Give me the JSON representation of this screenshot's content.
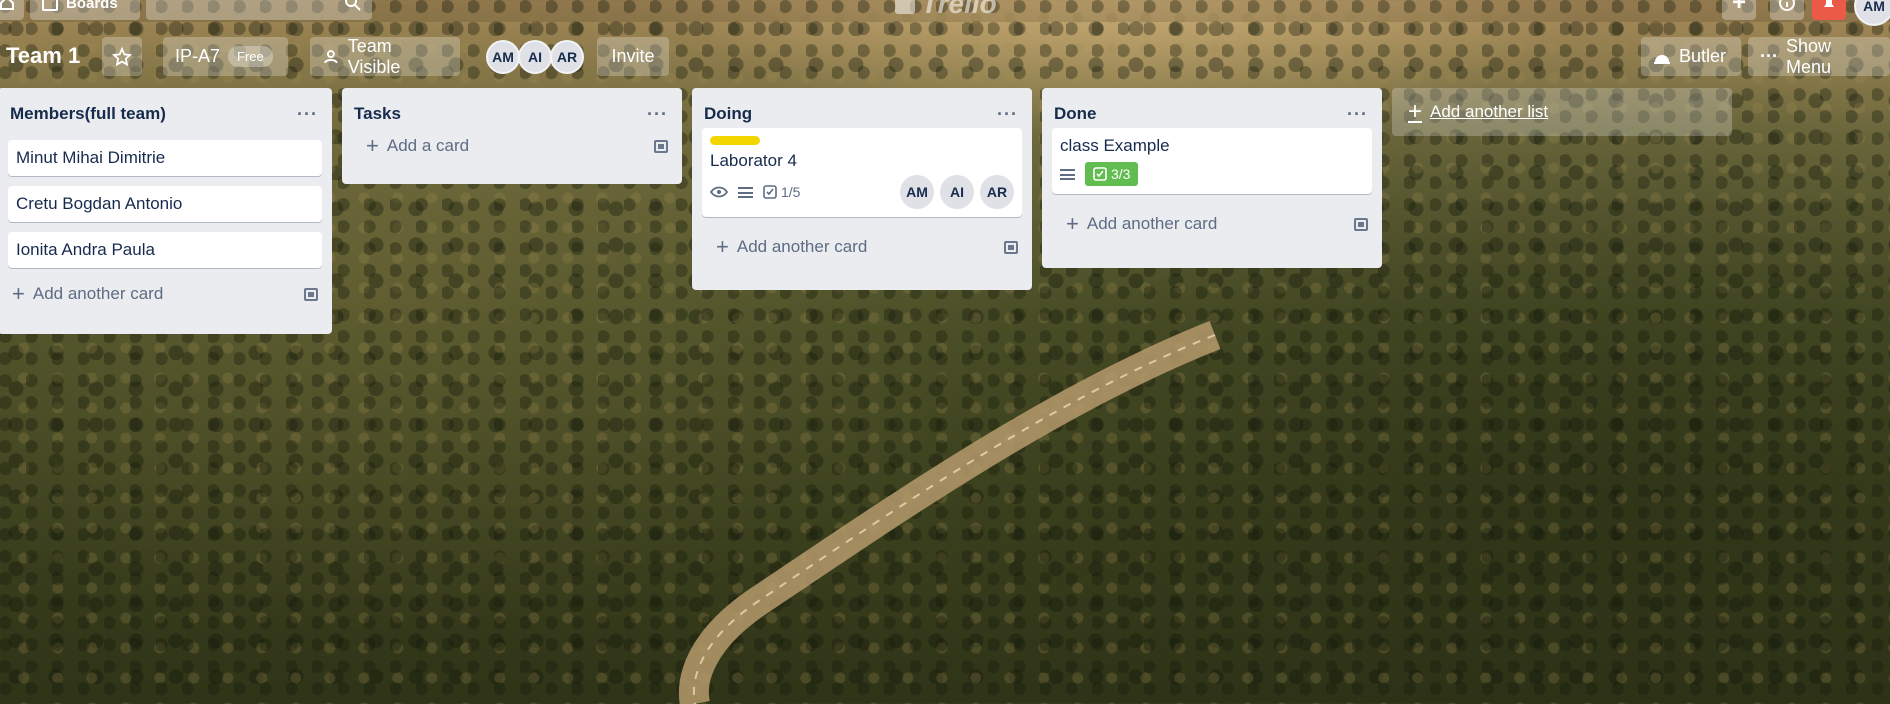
{
  "topbar": {
    "boards_label": "Boards",
    "logo_text": "Trello"
  },
  "board": {
    "title": "Team 1",
    "workspace_name": "IP-A7",
    "workspace_badge": "Free",
    "visibility_label": "Team Visible",
    "members": [
      "AM",
      "AI",
      "AR"
    ],
    "invite_label": "Invite",
    "butler_label": "Butler",
    "show_menu_label": "Show Menu",
    "user_avatar": "AM"
  },
  "lists": [
    {
      "title": "Members(full team)",
      "cards": [
        {
          "title": "Minut Mihai Dimitrie"
        },
        {
          "title": "Cretu Bogdan Antonio"
        },
        {
          "title": "Ionita Andra Paula"
        }
      ],
      "add_label": "Add another card"
    },
    {
      "title": "Tasks",
      "cards": [],
      "add_label": "Add a card"
    },
    {
      "title": "Doing",
      "cards": [
        {
          "title": "Laborator 4",
          "label_color": "#f2d600",
          "checklist": "1/5",
          "members": [
            "AM",
            "AI",
            "AR"
          ]
        }
      ],
      "add_label": "Add another card"
    },
    {
      "title": "Done",
      "cards": [
        {
          "title": "class Example",
          "checklist": "3/3"
        }
      ],
      "add_label": "Add another card"
    }
  ],
  "add_list_label": "Add another list",
  "colors": {
    "list_bg": "#ebecf0",
    "label_yellow": "#f2d600",
    "check_done_green": "#61bd4f",
    "notification_red": "#eb5a46"
  }
}
